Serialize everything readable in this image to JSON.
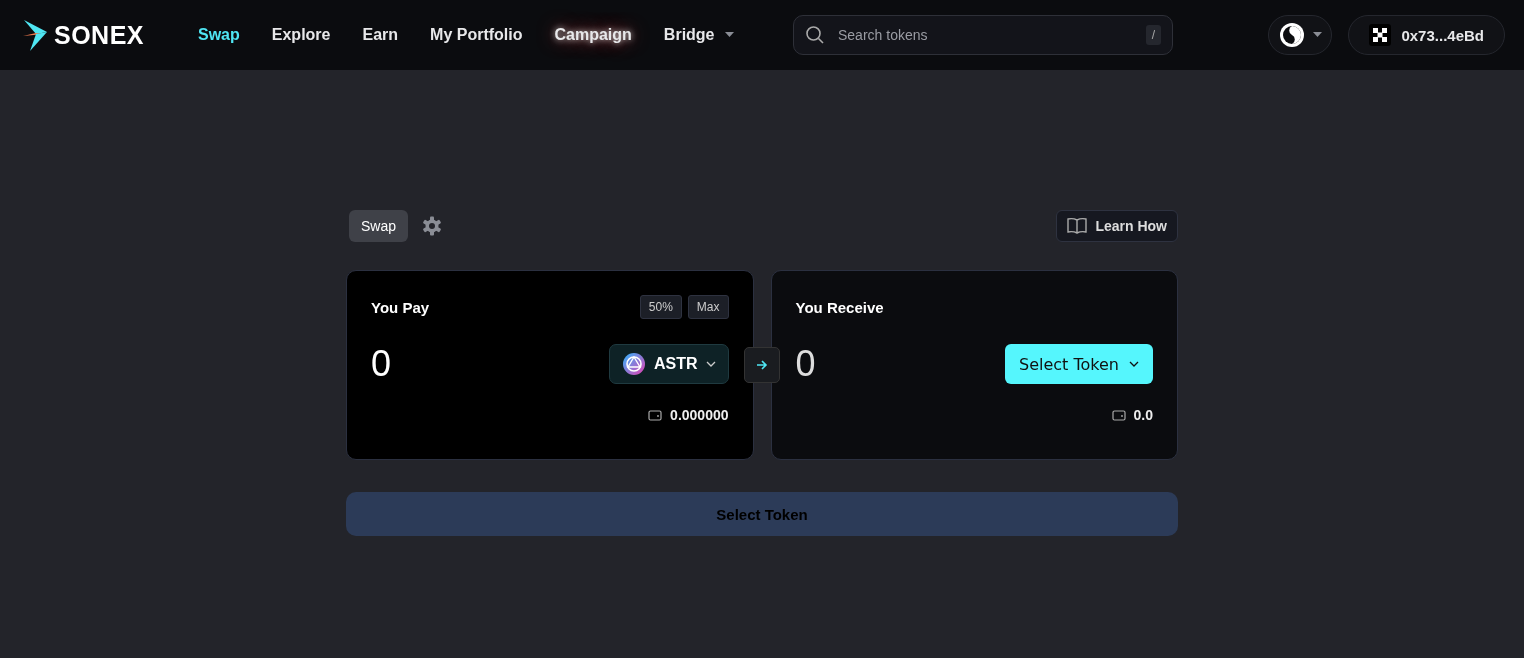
{
  "header": {
    "brand": "SONEX",
    "nav": [
      {
        "label": "Swap",
        "selected": true,
        "glow": false,
        "dropdown": false
      },
      {
        "label": "Explore",
        "selected": false,
        "glow": false,
        "dropdown": false
      },
      {
        "label": "Earn",
        "selected": false,
        "glow": false,
        "dropdown": false
      },
      {
        "label": "My Portfolio",
        "selected": false,
        "glow": false,
        "dropdown": false
      },
      {
        "label": "Campaign",
        "selected": false,
        "glow": true,
        "dropdown": false
      },
      {
        "label": "Bridge",
        "selected": false,
        "glow": false,
        "dropdown": true
      }
    ],
    "search": {
      "placeholder": "Search tokens",
      "shortcut": "/"
    },
    "wallet": {
      "address": "0x73...4eBd"
    }
  },
  "swap": {
    "tab": "Swap",
    "learn": "Learn How",
    "pay": {
      "title": "You Pay",
      "amount": "0",
      "quick": [
        "50%",
        "Max"
      ],
      "token": "ASTR",
      "balance": "0.000000"
    },
    "receive": {
      "title": "You Receive",
      "amount": "0",
      "token": "Select Token",
      "balance": "0.0"
    },
    "action": "Select Token"
  }
}
